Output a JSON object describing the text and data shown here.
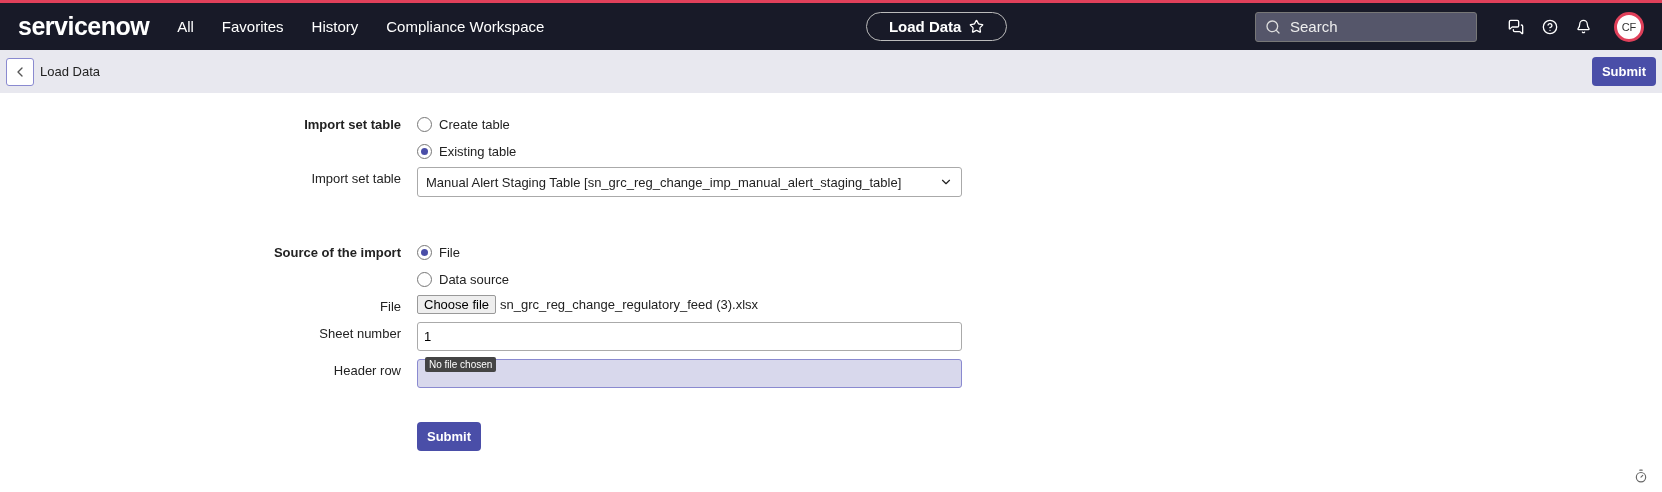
{
  "top_nav": {
    "logo": "servicenow",
    "links": [
      "All",
      "Favorites",
      "History",
      "Compliance Workspace"
    ],
    "page_pill": {
      "label": "Load Data",
      "favorited": false
    },
    "search": {
      "placeholder": "Search"
    },
    "avatar": {
      "initials": "CF"
    }
  },
  "sub_header": {
    "title": "Load Data",
    "submit": "Submit"
  },
  "form": {
    "rows": [
      {
        "kind": "radio",
        "label": "Import set table",
        "options": [
          {
            "label": "Create table",
            "selected": false
          },
          {
            "label": "Existing table",
            "selected": true
          }
        ]
      },
      {
        "kind": "select",
        "label": "Import set table",
        "value": "Manual Alert Staging Table [sn_grc_reg_change_imp_manual_alert_staging_table]"
      },
      {
        "kind": "spacer"
      },
      {
        "kind": "radio",
        "label": "Source of the import",
        "options": [
          {
            "label": "File",
            "selected": true
          },
          {
            "label": "Data source",
            "selected": false
          }
        ]
      },
      {
        "kind": "file",
        "label": "File",
        "button": "Choose file",
        "filename": "sn_grc_reg_change_regulatory_feed (3).xlsx"
      },
      {
        "kind": "input",
        "label": "Sheet number",
        "value": "1",
        "highlighted": false
      },
      {
        "kind": "input",
        "label": "Header row",
        "highlighted": true,
        "tooltip": "No file chosen"
      }
    ],
    "submit": "Submit"
  }
}
